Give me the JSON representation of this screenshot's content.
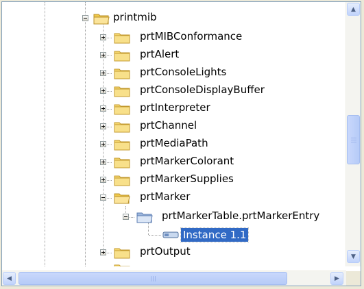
{
  "tree": {
    "root": {
      "label": "printmib"
    },
    "children": [
      {
        "label": "prtMIBConformance"
      },
      {
        "label": "prtAlert"
      },
      {
        "label": "prtConsoleLights"
      },
      {
        "label": "prtConsoleDisplayBuffer"
      },
      {
        "label": "prtInterpreter"
      },
      {
        "label": "prtChannel"
      },
      {
        "label": "prtMediaPath"
      },
      {
        "label": "prtMarkerColorant"
      },
      {
        "label": "prtMarkerSupplies"
      },
      {
        "label": "prtMarker"
      }
    ],
    "table_entry": {
      "label": "prtMarkerTable.prtMarkerEntry"
    },
    "instance": {
      "label": "Instance 1.1"
    },
    "after": {
      "label": "prtOutput"
    }
  },
  "icons": {
    "folder": "folder-icon",
    "table": "table-folder-icon",
    "instance": "instance-icon"
  },
  "colors": {
    "selection": "#316ac5",
    "folder": "#f5d76e",
    "scrollbar": "#c1d3fb"
  }
}
